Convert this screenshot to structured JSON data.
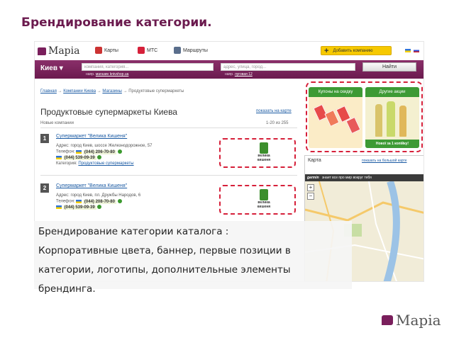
{
  "slide": {
    "title": "Брендирование категории.",
    "caption_lines": [
      "Брендирование категории каталога :",
      "Корпоративные цвета, баннер, первые позиции в",
      "категории, логотипы, дополнительные элементы",
      "брендинга."
    ],
    "footer_logo": "Mapia"
  },
  "site": {
    "logo": "Mapia",
    "nav": [
      {
        "label": "Карты",
        "icon": "map-icon",
        "color": "#cc3333"
      },
      {
        "label": "МТС",
        "icon": "mts-icon",
        "color": "#d6203a"
      },
      {
        "label": "Маршруты",
        "icon": "route-icon",
        "color": "#5a6e8c"
      }
    ],
    "add_company_label": "Добавить компанию",
    "city": "Киев",
    "search": {
      "company_placeholder": "компания, категория...",
      "company_hint_prefix": "напр. ",
      "company_hint_link": "магазин knivshop.ua",
      "address_placeholder": "адрес, улица, город...",
      "address_hint_prefix": "напр. ",
      "address_hint_link": "луговая 12",
      "find_label": "Найти"
    },
    "breadcrumb": [
      "Главная",
      "Компании Киева",
      "Магазины",
      "Продуктовые супермаркеты"
    ],
    "heading": "Продуктовые супермаркеты Киева",
    "show_on_map": "показать на карте",
    "new_companies": "Новые компании",
    "range": "1-20 из 255",
    "listings": [
      {
        "num": "1",
        "name": "Супермаркет \"Велика Кишеня\"",
        "address": "Адрес: город Киев, шоссе Железнодорожное, 57",
        "phone_label": "Телефон:",
        "phones": [
          "(044) 206-70-80",
          "(044) 539-09-39"
        ],
        "category_label": "Категория: ",
        "category": "Продуктовые супермаркеты"
      },
      {
        "num": "2",
        "name": "Супермаркет \"Велика Кишеня\"",
        "address": "Адрес: город Киев, пл. Дружбы Народов, 6",
        "phone_label": "Телефон:",
        "phones": [
          "(044) 208-70-80",
          "(044) 539-09-39"
        ],
        "category_label": "Категория: ",
        "category": "Продуктовые супермаркеты"
      }
    ],
    "brand_logo_text": [
      "велика",
      "кишеня"
    ],
    "promos": [
      {
        "title": "Купоны на скидку"
      },
      {
        "title": "Другие акции",
        "footer": "Нової за 1 копійку!"
      }
    ],
    "map": {
      "title": "Карта",
      "show_big": "показать на большой карте",
      "strip_brand": "garmin",
      "strip_text": "знает все про мир вокруг тебя",
      "zoom_in": "+",
      "zoom_out": "−"
    },
    "colors": {
      "brand": "#7a1f5c",
      "accent_red": "#d6203a",
      "promo_green": "#3d9a35",
      "link": "#1a5aa3"
    }
  }
}
